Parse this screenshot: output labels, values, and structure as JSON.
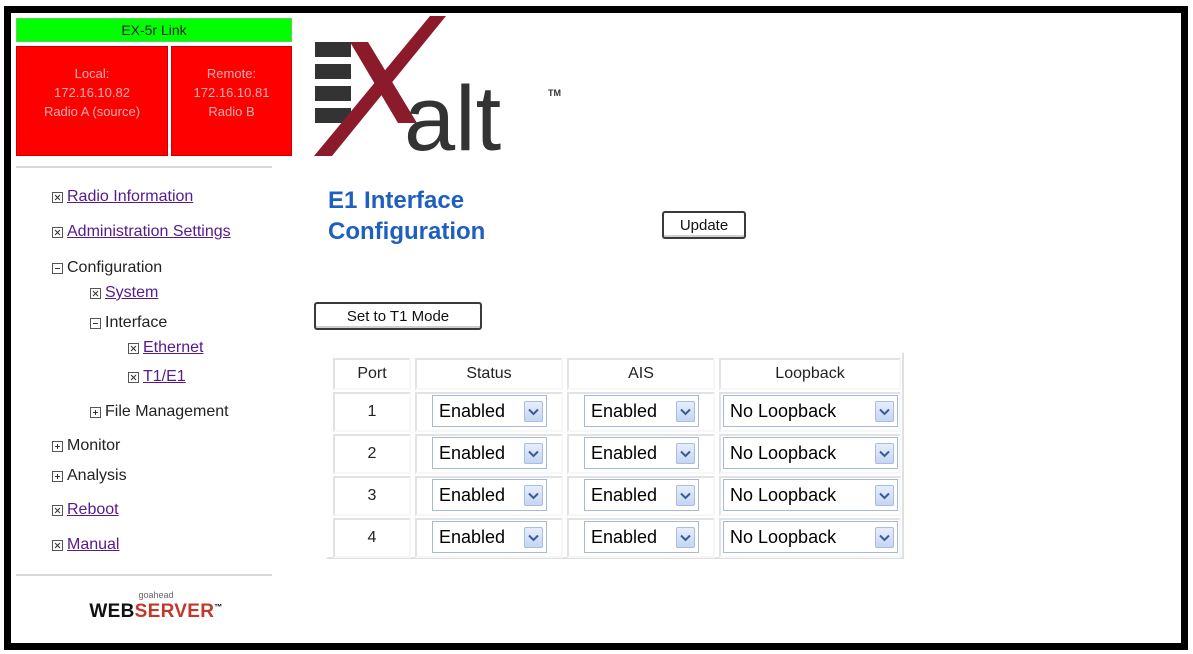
{
  "status": {
    "link_title": "EX-5r Link",
    "local": {
      "label": "Local:",
      "ip": "172.16.10.82",
      "role": "Radio A (source)"
    },
    "remote": {
      "label": "Remote:",
      "ip": "172.16.10.81",
      "role": "Radio B"
    },
    "colors": {
      "link_ok": "#00ff00",
      "radio_alarm": "#ff0000"
    }
  },
  "nav": {
    "radio_information": "Radio Information",
    "administration_settings": "Administration Settings",
    "configuration": "Configuration",
    "system": "System",
    "interface": "Interface",
    "ethernet": "Ethernet",
    "t1e1": "T1/E1",
    "file_management": "File Management",
    "monitor": "Monitor",
    "analysis": "Analysis",
    "reboot": "Reboot",
    "manual": "Manual"
  },
  "footer": {
    "small": "goahead",
    "web": "WEB",
    "server": "SERVER",
    "tm": "™"
  },
  "logo": {
    "text": "alt",
    "tm": "TM"
  },
  "page": {
    "title_line1": "E1 Interface",
    "title_line2": "Configuration",
    "update_button": "Update",
    "t1_mode_button": "Set to T1 Mode"
  },
  "table": {
    "headers": {
      "port": "Port",
      "status": "Status",
      "ais": "AIS",
      "loopback": "Loopback"
    },
    "rows": [
      {
        "port": "1",
        "status": "Enabled",
        "ais": "Enabled",
        "loopback": "No Loopback"
      },
      {
        "port": "2",
        "status": "Enabled",
        "ais": "Enabled",
        "loopback": "No Loopback"
      },
      {
        "port": "3",
        "status": "Enabled",
        "ais": "Enabled",
        "loopback": "No Loopback"
      },
      {
        "port": "4",
        "status": "Enabled",
        "ais": "Enabled",
        "loopback": "No Loopback"
      }
    ]
  }
}
